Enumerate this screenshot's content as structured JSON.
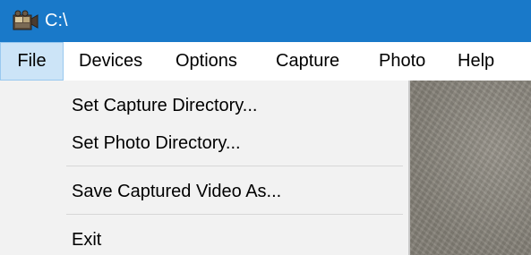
{
  "window": {
    "title": "C:\\",
    "icon": "camera-app-icon"
  },
  "menubar": {
    "items": [
      {
        "label": "File",
        "active": true
      },
      {
        "label": "Devices"
      },
      {
        "label": "Options"
      },
      {
        "label": "Capture"
      },
      {
        "label": "Photo"
      },
      {
        "label": "Help"
      }
    ]
  },
  "file_menu": {
    "items": [
      {
        "label": "Set Capture Directory..."
      },
      {
        "label": "Set Photo Directory..."
      },
      {
        "label": "Save Captured Video As..."
      },
      {
        "label": "Exit"
      }
    ]
  },
  "colors": {
    "titlebar": "#1979c9",
    "menu_highlight": "#cce4f7",
    "dropdown_bg": "#f2f2f2"
  }
}
